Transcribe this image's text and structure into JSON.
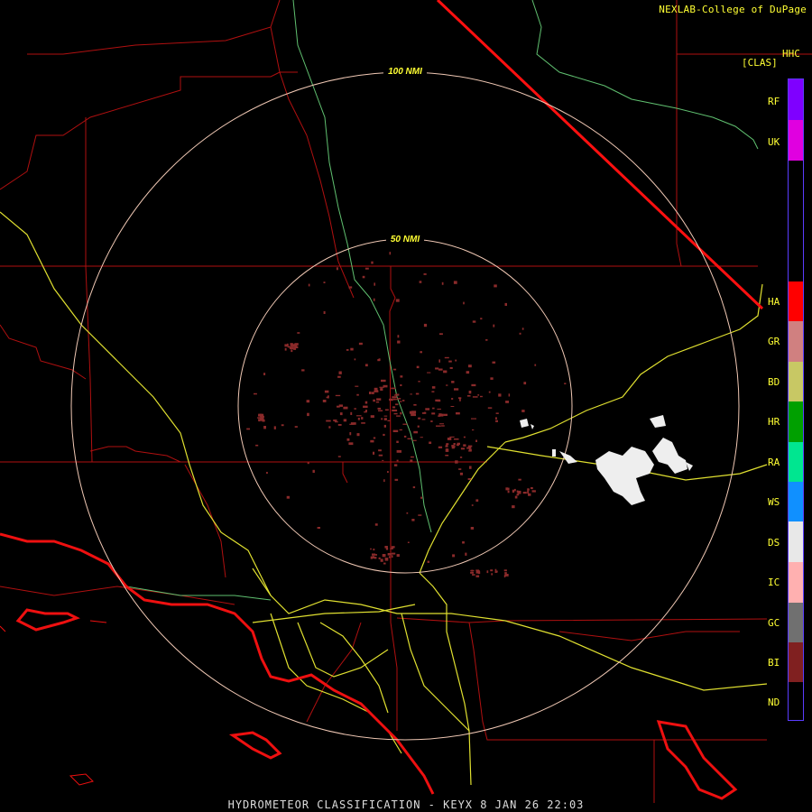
{
  "credit": "NEXLAB-College of DuPage",
  "legend": {
    "title": "HHC",
    "subtitle": "[CLAS]",
    "classes": [
      {
        "code": "RF",
        "color": "#7f00ff"
      },
      {
        "code": "UK",
        "color": "#e000e0"
      },
      {
        "code": "HA",
        "color": "#ff0000"
      },
      {
        "code": "GR",
        "color": "#d08080"
      },
      {
        "code": "BD",
        "color": "#c8c864"
      },
      {
        "code": "HR",
        "color": "#00a000"
      },
      {
        "code": "RA",
        "color": "#00e690"
      },
      {
        "code": "WS",
        "color": "#1090ff"
      },
      {
        "code": "DS",
        "color": "#e8e8e8"
      },
      {
        "code": "IC",
        "color": "#ffb0b0"
      },
      {
        "code": "GC",
        "color": "#707070"
      },
      {
        "code": "BI",
        "color": "#802020"
      },
      {
        "code": "ND",
        "color": "#000000"
      }
    ]
  },
  "range_rings": {
    "inner_label": "50 NMI",
    "outer_label": "100 NMI"
  },
  "footer": "HYDROMETEOR CLASSIFICATION - KEYX 8 JAN 26 22:03"
}
